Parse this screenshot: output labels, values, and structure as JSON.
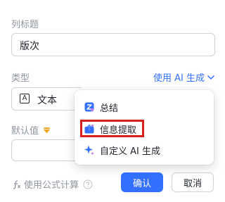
{
  "column_title": {
    "label": "列标题",
    "value": "版次"
  },
  "type": {
    "label": "类型",
    "ai_generate_link": "使用 AI 生成",
    "selected_value": "文本",
    "selected_icon_glyph": "A",
    "selected_icon": "text-type-icon"
  },
  "default_value": {
    "label": "默认值",
    "badge_icon": "premium-diamond-icon",
    "value": ""
  },
  "formula": {
    "icon": "formula-icon",
    "label": "使用公式计算",
    "help_icon": "question-circle-icon"
  },
  "ai_menu": {
    "items": [
      {
        "label": "总结",
        "icon": "summary-icon"
      },
      {
        "label": "信息提取",
        "icon": "extract-icon",
        "highlighted": true
      },
      {
        "label": "自定义 AI 生成",
        "icon": "sparkle-icon"
      }
    ]
  },
  "actions": {
    "confirm_label": "确认",
    "cancel_label": "取消"
  },
  "colors": {
    "accent": "#3370ff",
    "highlight_border": "#d91e1e",
    "label_gray": "#8f959e"
  }
}
